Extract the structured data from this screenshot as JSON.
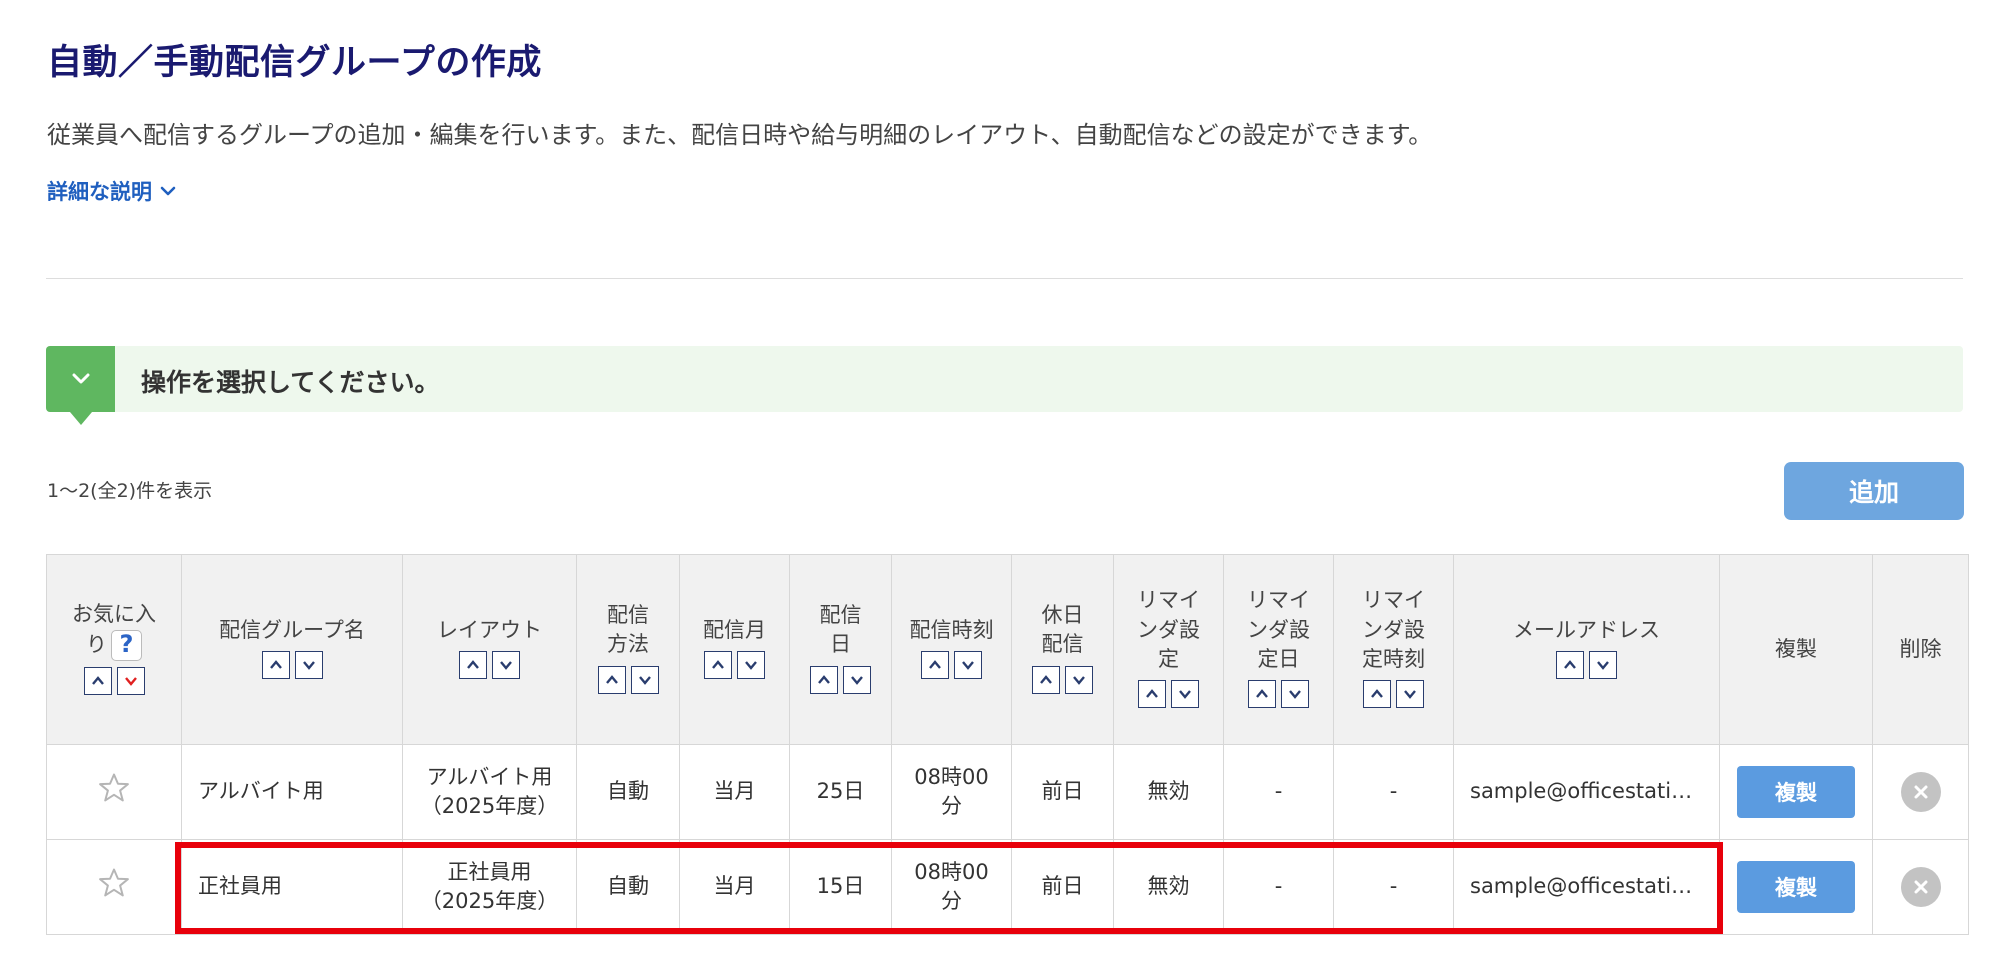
{
  "page": {
    "title": "自動／手動配信グループの作成",
    "description": "従業員へ配信するグループの追加・編集を行います。また、配信日時や給与明細のレイアウト、自動配信などの設定ができます。",
    "detail_link": "詳細な説明",
    "operation_prompt": "操作を選択してください。",
    "count_text": "1〜2(全2)件を表示",
    "add_button": "追加"
  },
  "colors": {
    "title": "#1a1a70",
    "link": "#1f5fbf",
    "op_bar_bg": "#eef8ed",
    "op_toggle": "#5fb760",
    "add_button": "#6ea6df",
    "dup_button": "#5b9be0",
    "highlight": "#e8000b",
    "sort_active": "#e02020"
  },
  "table": {
    "headers": {
      "favorite": "お気に入り",
      "favorite_help": "?",
      "group_name": "配信グループ名",
      "layout": "レイアウト",
      "method": "配信方法",
      "month": "配信月",
      "day": "配信日",
      "time": "配信時刻",
      "holiday": "休日配信",
      "reminder": "リマインダ設定",
      "reminder_day": "リマインダ設定日",
      "reminder_time": "リマインダ設定時刻",
      "email": "メールアドレス",
      "duplicate": "複製",
      "delete": "削除"
    },
    "rows": [
      {
        "group_name": "アルバイト用",
        "layout_line1": "アルバイト用",
        "layout_line2": "（2025年度）",
        "method": "自動",
        "month": "当月",
        "day": "25日",
        "time_line1": "08時00",
        "time_line2": "分",
        "holiday": "前日",
        "reminder": "無効",
        "reminder_day": "-",
        "reminder_time": "-",
        "email": "sample@officestati…",
        "duplicate": "複製"
      },
      {
        "group_name": "正社員用",
        "layout_line1": "正社員用",
        "layout_line2": "（2025年度）",
        "method": "自動",
        "month": "当月",
        "day": "15日",
        "time_line1": "08時00",
        "time_line2": "分",
        "holiday": "前日",
        "reminder": "無効",
        "reminder_day": "-",
        "reminder_time": "-",
        "email": "sample@officestati…",
        "duplicate": "複製"
      }
    ]
  },
  "icons": {
    "detail_chevron": "chevron-down-icon",
    "op_toggle": "chevron-down-icon",
    "favorite": "star-outline-icon",
    "delete": "close-circle-icon",
    "sort_up": "chevron-up-icon",
    "sort_down": "chevron-down-icon"
  }
}
